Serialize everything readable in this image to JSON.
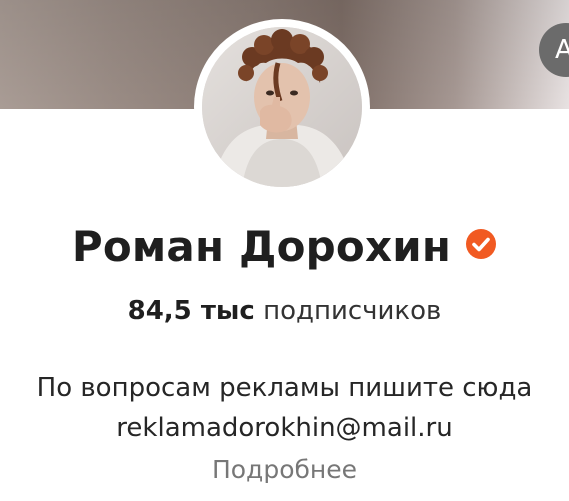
{
  "channel": {
    "name": "Роман Дорохин",
    "verified_icon": "verified-check-icon",
    "subscribers_count": "84,5 тыс",
    "subscribers_label": "подписчиков",
    "description_line1": "По вопросам рекламы пишите сюда",
    "description_line2": "reklamadorokhin@mail.ru",
    "more_link": "Подробнее",
    "corner_button_glyph": "А"
  },
  "colors": {
    "verified_badge": "#f15a22",
    "text_primary": "#1f1f1f",
    "text_secondary": "#777777"
  }
}
